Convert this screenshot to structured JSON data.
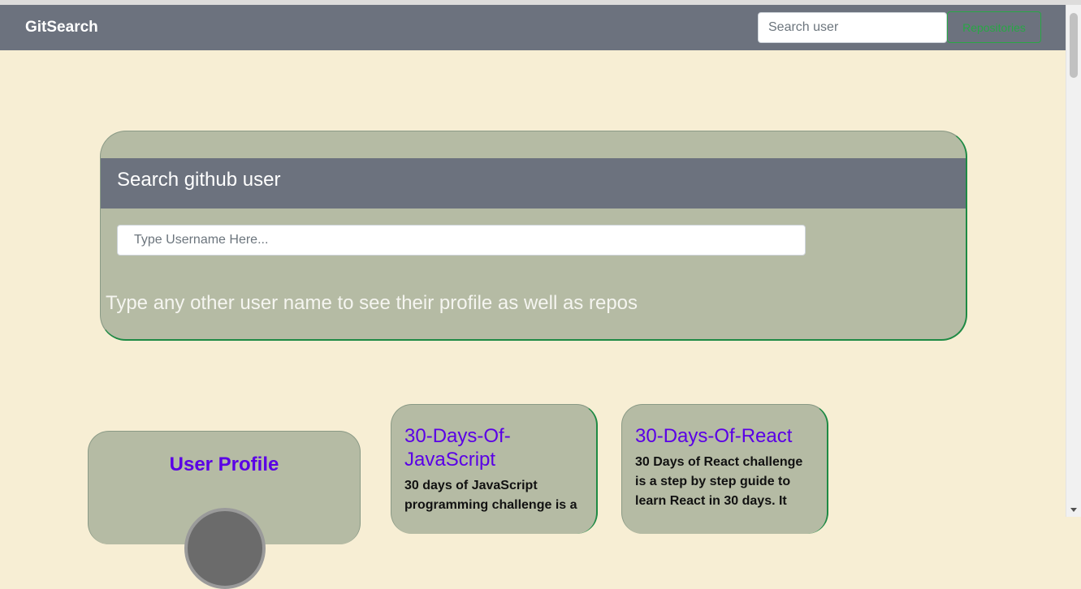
{
  "navbar": {
    "brand": "GitSearch",
    "search_placeholder": "Search user",
    "repos_button": "Repositories"
  },
  "search_card": {
    "title": "Search github user",
    "input_placeholder": "Type Username Here...",
    "hint": "Type any other user name to see their profile as well as repos"
  },
  "profile": {
    "title": "User Profile"
  },
  "repos": [
    {
      "name": "30-Days-Of-JavaScript",
      "description": "30 days of JavaScript programming challenge is a"
    },
    {
      "name": "30-Days-Of-React",
      "description": "30 Days of React challenge is a step by step guide to learn React in 30 days. It"
    }
  ],
  "colors": {
    "page_bg": "#f7eed4",
    "navbar_bg": "#6c727e",
    "card_bg": "#b5bba4",
    "accent_green": "#28a745",
    "link_purple": "#5a00e6"
  }
}
